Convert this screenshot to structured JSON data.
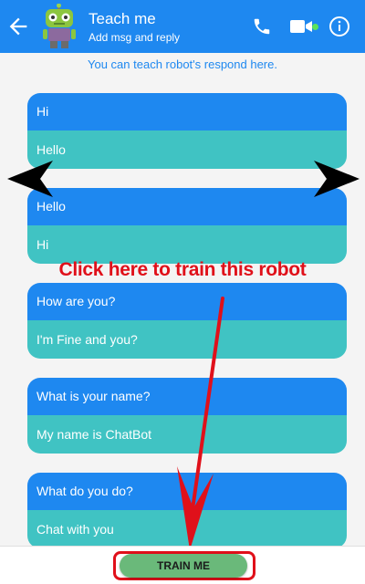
{
  "header": {
    "title": "Teach me",
    "subtitle": "Add msg and reply",
    "back_icon": "arrow-back-icon",
    "avatar": "robot-avatar",
    "actions": [
      "phone-icon",
      "video-camera-icon",
      "info-icon"
    ],
    "online_color": "#5be35b"
  },
  "hint": "You can teach robot's respond here.",
  "pairs": [
    {
      "question": "Hi",
      "answer": "Hello"
    },
    {
      "question": "Hello",
      "answer": "Hi"
    },
    {
      "question": "How are you?",
      "answer": "I'm Fine and you?"
    },
    {
      "question": "What is your name?",
      "answer": "My name is ChatBot"
    },
    {
      "question": "What do you do?",
      "answer": "Chat with you"
    }
  ],
  "annotation": "Click here to train this robot",
  "train_button": "TRAIN ME",
  "colors": {
    "primary": "#1e88f0",
    "answer": "#40c3c3",
    "annotation": "#e0101a",
    "train_button": "#6ab97a"
  }
}
